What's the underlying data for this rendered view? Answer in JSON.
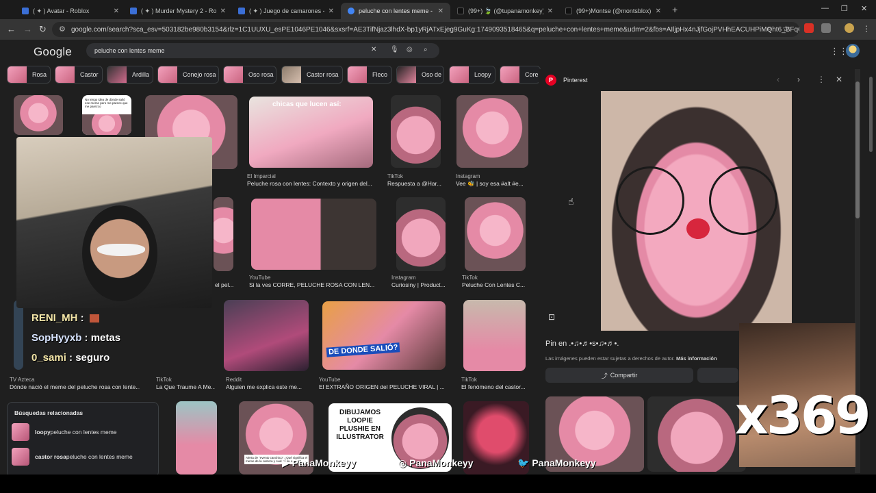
{
  "tabs": [
    {
      "title": "( ✦ ) Avatar - Roblox",
      "color": "#3b6fd6"
    },
    {
      "title": "( ✦ ) Murder Mystery 2 - Roblox",
      "color": "#3b6fd6"
    },
    {
      "title": "( ✦ ) Juego de camarones - Roblox",
      "color": "#3b6fd6"
    },
    {
      "title": "peluche con lentes meme - Buscar",
      "color": "#4285f4"
    },
    {
      "title": "(99+) 🍃 (@tupanamonkey) | TikTok",
      "color": "#111111"
    },
    {
      "title": "(99+)Montse (@montsblox) | TikTok",
      "color": "#111111"
    }
  ],
  "url": "google.com/search?sca_esv=503182be980b3154&rlz=1C1UUXU_esPE1046PE1046&sxsrf=AE3TifNjaz3lhdX-bp1yRjATxEjeg9GuKg:1749093518465&q=peluche+con+lentes+meme&udm=2&fbs=AIljpHx4nJjfGojPVHhEACUHPiMQht6_BFq6vBIoFF...",
  "google_logo": "Google",
  "search_query": "peluche con lentes meme",
  "chips": [
    "Rosa",
    "Castor",
    "Ardilla",
    "Conejo rosa",
    "Oso rosa",
    "Castor rosa",
    "Fleco",
    "Oso de",
    "Loopy",
    "Core"
  ],
  "grid": {
    "r1": [
      {
        "source": "El Imparcial",
        "caption": "Peluche rosa con lentes: Contexto y origen del..."
      },
      {
        "source": "TikTok",
        "caption": "Respuesta a @Har..."
      },
      {
        "source": "Instagram",
        "caption": "Vee 🐝 | soy esa #alt #e..."
      }
    ],
    "r1_overlay": "chicas que lucen así:",
    "r1_note": "No tengo idea de dónde salió ese meme pero me parece que me parezco",
    "r2": [
      {
        "source": "YouTube",
        "caption": "Si la ves CORRE, PELUCHE ROSA CON LEN..."
      },
      {
        "source": "Instagram",
        "caption": "Curiosiny | Product..."
      },
      {
        "source": "TikTok",
        "caption": "Peluche Con Lentes C..."
      }
    ],
    "r2_partial": "el pel...",
    "r3": [
      {
        "source": "Reddit",
        "caption": "Alguien me explica este me..."
      },
      {
        "source": "YouTube",
        "caption": "El EXTRAÑO ORIGEN del PELUCHE VIRAL | ..."
      },
      {
        "source": "TikTok",
        "caption": "El fenómeno del castor..."
      }
    ],
    "r3_left": [
      {
        "source": "TV Azteca",
        "caption": "Dónde nació el meme del peluche rosa con lente..."
      },
      {
        "source": "TikTok",
        "caption": "La Que Traume A Me..."
      }
    ],
    "r3_overlay": "DE DONDE SALIÓ?",
    "r4_overlay": "DIBUJAMOS LOOPIE PLUSHIE EN ILLUSTRATOR",
    "r4_note": "Alerta de \"evento canónico\" ¿Qué significa el meme de la castora y cual es su origen?"
  },
  "related": {
    "title": "Búsquedas relacionadas",
    "items": [
      {
        "bold": "loopy",
        "rest": " peluche con lentes meme"
      },
      {
        "bold": "castor rosa",
        "rest": " peluche con lentes meme"
      }
    ]
  },
  "chat": [
    {
      "user": "RENI_MH",
      "msg": ""
    },
    {
      "user": "SopHyyxb",
      "msg": "metas"
    },
    {
      "user": "0_sami",
      "msg": "seguro"
    }
  ],
  "panel": {
    "source": "Pinterest",
    "pin_title": "Pin en .•♫•♬•s•♫•♬•.",
    "note": "Las imágenes pueden estar sujetas a derechos de autor.",
    "more": "Más información",
    "share": "Compartir"
  },
  "overlay_counter": "x369",
  "socials": [
    "PanaMonkeyy",
    "PanaMonkeyy",
    "PanaMonkeyy"
  ]
}
